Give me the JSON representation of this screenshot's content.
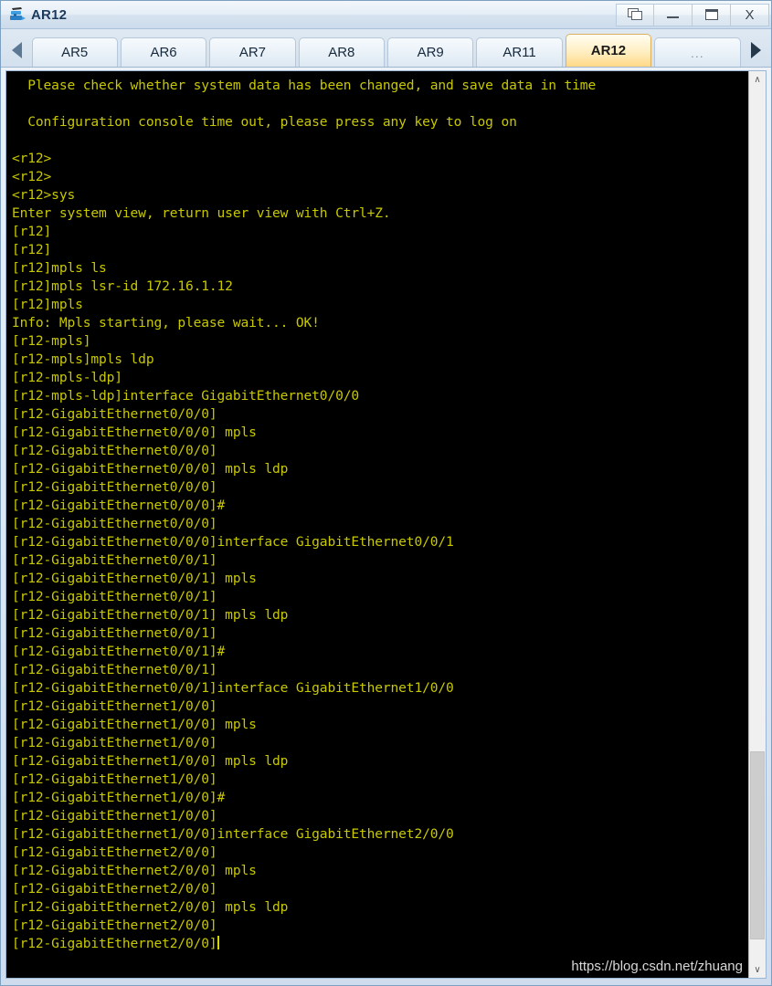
{
  "window": {
    "title": "AR12",
    "icon": "router-icon",
    "controls": [
      {
        "name": "restore-button",
        "icon": "restore-icon",
        "label": ""
      },
      {
        "name": "minimize-button",
        "icon": "minimize-icon",
        "label": ""
      },
      {
        "name": "maximize-button",
        "icon": "maximize-icon",
        "label": ""
      },
      {
        "name": "close-button",
        "icon": "close-icon",
        "label": "X"
      }
    ]
  },
  "tabbar": {
    "scroll_left": "◀",
    "scroll_right": "▶",
    "tabs": [
      {
        "label": "AR5",
        "active": false
      },
      {
        "label": "AR6",
        "active": false
      },
      {
        "label": "AR7",
        "active": false
      },
      {
        "label": "AR8",
        "active": false
      },
      {
        "label": "AR9",
        "active": false
      },
      {
        "label": "AR11",
        "active": false
      },
      {
        "label": "AR12",
        "active": true
      },
      {
        "label": "...",
        "active": false
      }
    ]
  },
  "terminal": {
    "text_color": "#c8c800",
    "background_color": "#000000",
    "lines": [
      "  Please check whether system data has been changed, and save data in time",
      "",
      "  Configuration console time out, please press any key to log on",
      "",
      "<r12>",
      "<r12>",
      "<r12>sys",
      "Enter system view, return user view with Ctrl+Z.",
      "[r12]",
      "[r12]",
      "[r12]mpls ls",
      "[r12]mpls lsr-id 172.16.1.12",
      "[r12]mpls",
      "Info: Mpls starting, please wait... OK!",
      "[r12-mpls]",
      "[r12-mpls]mpls ldp",
      "[r12-mpls-ldp]",
      "[r12-mpls-ldp]interface GigabitEthernet0/0/0",
      "[r12-GigabitEthernet0/0/0]",
      "[r12-GigabitEthernet0/0/0] mpls",
      "[r12-GigabitEthernet0/0/0]",
      "[r12-GigabitEthernet0/0/0] mpls ldp",
      "[r12-GigabitEthernet0/0/0]",
      "[r12-GigabitEthernet0/0/0]#",
      "[r12-GigabitEthernet0/0/0]",
      "[r12-GigabitEthernet0/0/0]interface GigabitEthernet0/0/1",
      "[r12-GigabitEthernet0/0/1]",
      "[r12-GigabitEthernet0/0/1] mpls",
      "[r12-GigabitEthernet0/0/1]",
      "[r12-GigabitEthernet0/0/1] mpls ldp",
      "[r12-GigabitEthernet0/0/1]",
      "[r12-GigabitEthernet0/0/1]#",
      "[r12-GigabitEthernet0/0/1]",
      "[r12-GigabitEthernet0/0/1]interface GigabitEthernet1/0/0",
      "[r12-GigabitEthernet1/0/0]",
      "[r12-GigabitEthernet1/0/0] mpls",
      "[r12-GigabitEthernet1/0/0]",
      "[r12-GigabitEthernet1/0/0] mpls ldp",
      "[r12-GigabitEthernet1/0/0]",
      "[r12-GigabitEthernet1/0/0]#",
      "[r12-GigabitEthernet1/0/0]",
      "[r12-GigabitEthernet1/0/0]interface GigabitEthernet2/0/0",
      "[r12-GigabitEthernet2/0/0]",
      "[r12-GigabitEthernet2/0/0] mpls",
      "[r12-GigabitEthernet2/0/0]",
      "[r12-GigabitEthernet2/0/0] mpls ldp",
      "[r12-GigabitEthernet2/0/0]",
      "[r12-GigabitEthernet2/0/0]"
    ],
    "watermark": "https://blog.csdn.net/zhuang"
  },
  "scrollbar": {
    "up_arrow": "∧",
    "down_arrow": "∨"
  }
}
